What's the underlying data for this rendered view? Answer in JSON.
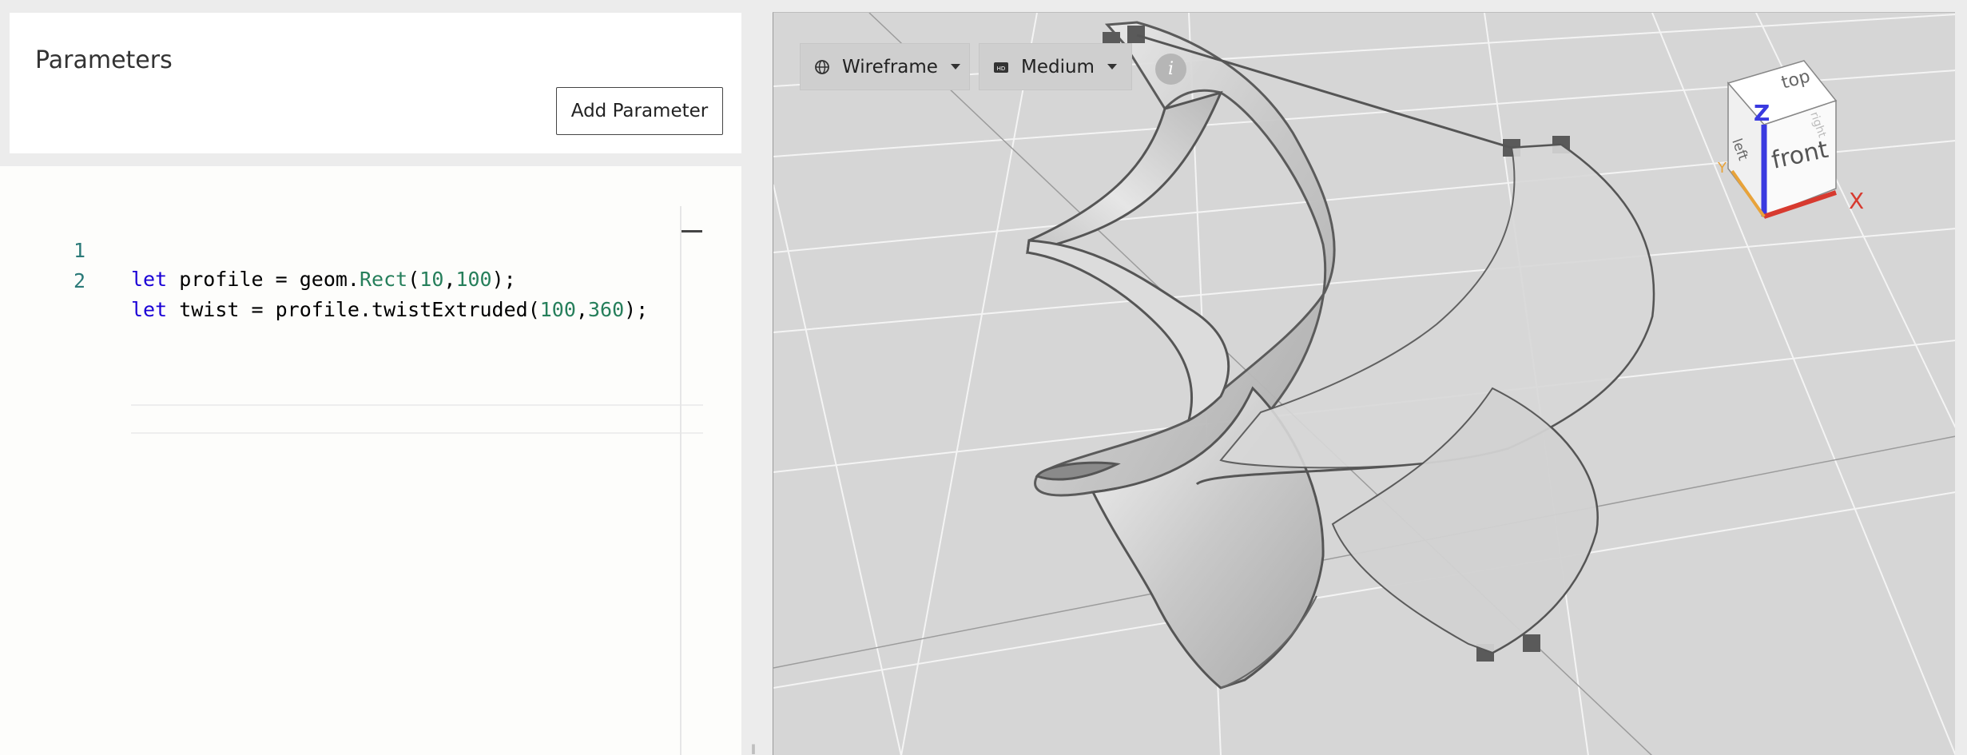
{
  "parameters": {
    "title": "Parameters",
    "add_button": "Add Parameter"
  },
  "editor": {
    "lines": [
      {
        "no": "1",
        "kw": "let",
        "name": " profile = geom.",
        "fn": "Rect",
        "open": "(",
        "a": "10",
        "comma": ",",
        "b": "100",
        "close": ");"
      },
      {
        "no": "2",
        "kw": "let",
        "name": " twist = profile.twistExtruded(",
        "fn": "",
        "open": "",
        "a": "100",
        "comma": ",",
        "b": "360",
        "close": ");"
      }
    ]
  },
  "viewport": {
    "render_mode": "Wireframe",
    "quality": "Medium",
    "info_label": "i",
    "render_mode_icon": "globe-icon",
    "quality_icon": "hd-icon"
  },
  "view_cube": {
    "faces": {
      "top": "top",
      "front": "front",
      "left": "left",
      "right": "right"
    },
    "axes": {
      "x": "X",
      "y": "Y",
      "z": "Z"
    },
    "colors": {
      "x": "#d73a2f",
      "y": "#e8a33a",
      "z": "#3a3ae0"
    }
  },
  "resize_handle": "‖"
}
